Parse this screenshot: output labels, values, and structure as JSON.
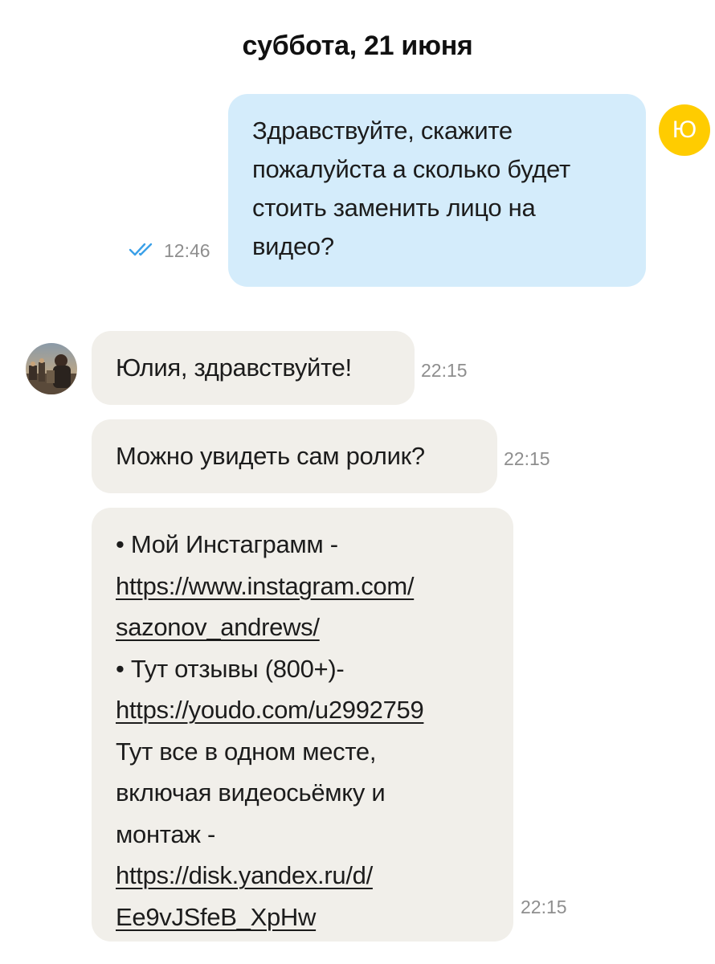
{
  "date_header": "суббота, 21 июня",
  "messages": [
    {
      "direction": "outgoing",
      "lines": [
        "Здравствуйте, скажите",
        "пожалуйста а сколько будет",
        "стоить заменить лицо на",
        "видео?"
      ],
      "time": "12:46",
      "status_icon": "double-check-icon",
      "avatar_letter": "Ю",
      "avatar_color": "#ffcc00",
      "bubble_color": "#d4ecfb"
    },
    {
      "direction": "incoming",
      "lines": [
        "Юлия, здравствуйте!"
      ],
      "time": "22:15",
      "bubble_color": "#f1efea"
    },
    {
      "direction": "incoming",
      "lines": [
        "Можно увидеть сам ролик?"
      ],
      "time": "22:15"
    },
    {
      "direction": "incoming",
      "lines": {
        "l1": "• Мой Инстаграмм -",
        "l2": "https://www.instagram.com/",
        "l3": "sazonov_andrews/",
        "l4": "• Тут отзывы (800+)-",
        "l5": "https://youdo.com/u2992759",
        "l6": "Тут все в одном месте,",
        "l7": "включая видеосьёмку и",
        "l8": "монтаж -",
        "l9": "https://disk.yandex.ru/d/",
        "l10": "Ee9vJSfeB_XpHw"
      },
      "time": "22:15"
    }
  ],
  "check_color": "#3aa0e8"
}
